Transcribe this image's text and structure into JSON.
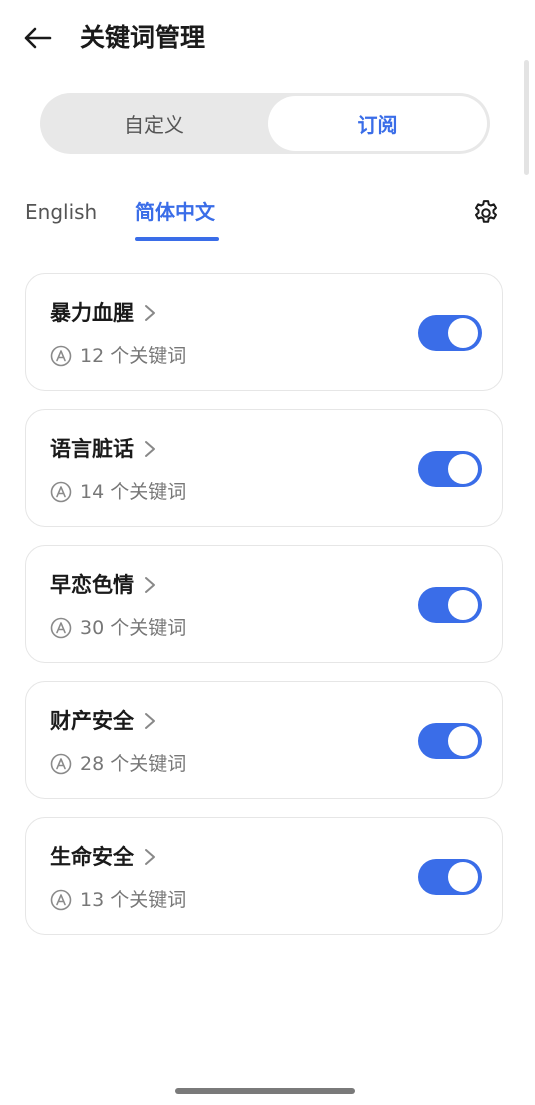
{
  "header": {
    "title": "关键词管理"
  },
  "segmented": {
    "left_label": "自定义",
    "right_label": "订阅"
  },
  "lang_tabs": {
    "english": "English",
    "chinese": "简体中文"
  },
  "colors": {
    "accent": "#3a6de8"
  },
  "cards": [
    {
      "title": "暴力血腥",
      "count": "12",
      "count_suffix": "个关键词",
      "enabled": true
    },
    {
      "title": "语言脏话",
      "count": "14",
      "count_suffix": "个关键词",
      "enabled": true
    },
    {
      "title": "早恋色情",
      "count": "30",
      "count_suffix": "个关键词",
      "enabled": true
    },
    {
      "title": "财产安全",
      "count": "28",
      "count_suffix": "个关键词",
      "enabled": true
    },
    {
      "title": "生命安全",
      "count": "13",
      "count_suffix": "个关键词",
      "enabled": true
    }
  ]
}
